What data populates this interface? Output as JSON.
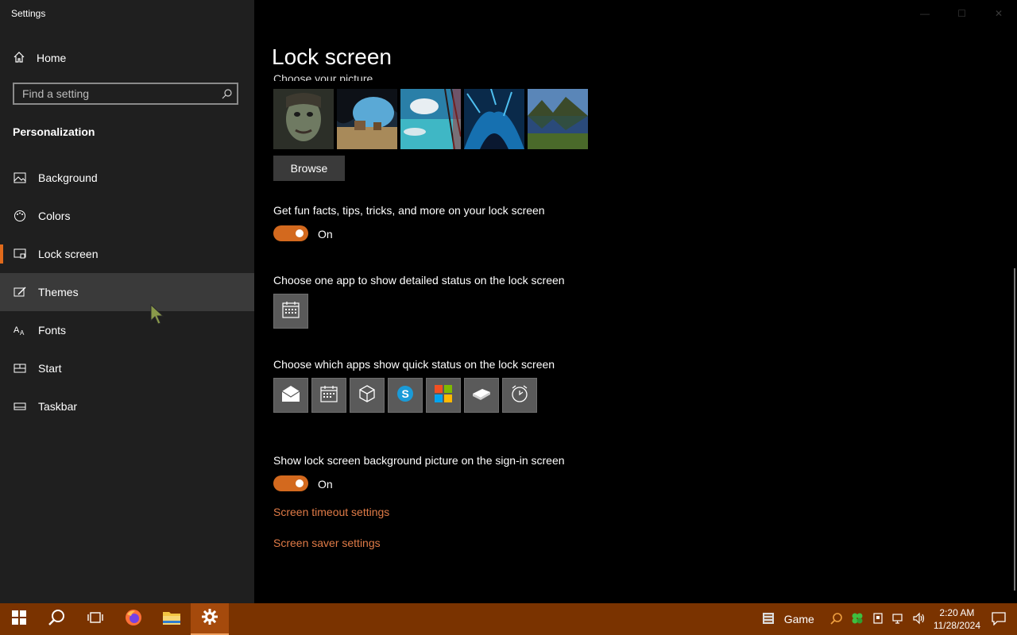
{
  "window": {
    "title": "Settings",
    "controls": [
      "—",
      "☐",
      "✕"
    ]
  },
  "sidebar": {
    "home_label": "Home",
    "search_placeholder": "Find a setting",
    "section_title": "Personalization",
    "items": [
      {
        "label": "Background",
        "icon": "picture-icon"
      },
      {
        "label": "Colors",
        "icon": "palette-icon"
      },
      {
        "label": "Lock screen",
        "icon": "lock-screen-icon",
        "selected": true
      },
      {
        "label": "Themes",
        "icon": "brush-icon",
        "hover": true
      },
      {
        "label": "Fonts",
        "icon": "fonts-icon"
      },
      {
        "label": "Start",
        "icon": "start-icon"
      },
      {
        "label": "Taskbar",
        "icon": "taskbar-icon"
      }
    ]
  },
  "main": {
    "title": "Lock screen",
    "choose_picture_label": "Choose your picture",
    "browse_label": "Browse",
    "fun_facts_label": "Get fun facts, tips, tricks, and more on your lock screen",
    "fun_facts_state": "On",
    "detailed_status_label": "Choose one app to show detailed status on the lock screen",
    "quick_status_label": "Choose which apps show quick status on the lock screen",
    "signin_bg_label": "Show lock screen background picture on the sign-in screen",
    "signin_bg_state": "On",
    "timeout_link": "Screen timeout settings",
    "saver_link": "Screen saver settings"
  },
  "taskbar": {
    "tray_label": "Game",
    "time": "2:20 AM",
    "date": "11/28/2024"
  },
  "colors": {
    "accent": "#d3691e",
    "taskbar": "#7a3300",
    "link": "#e07b47"
  }
}
